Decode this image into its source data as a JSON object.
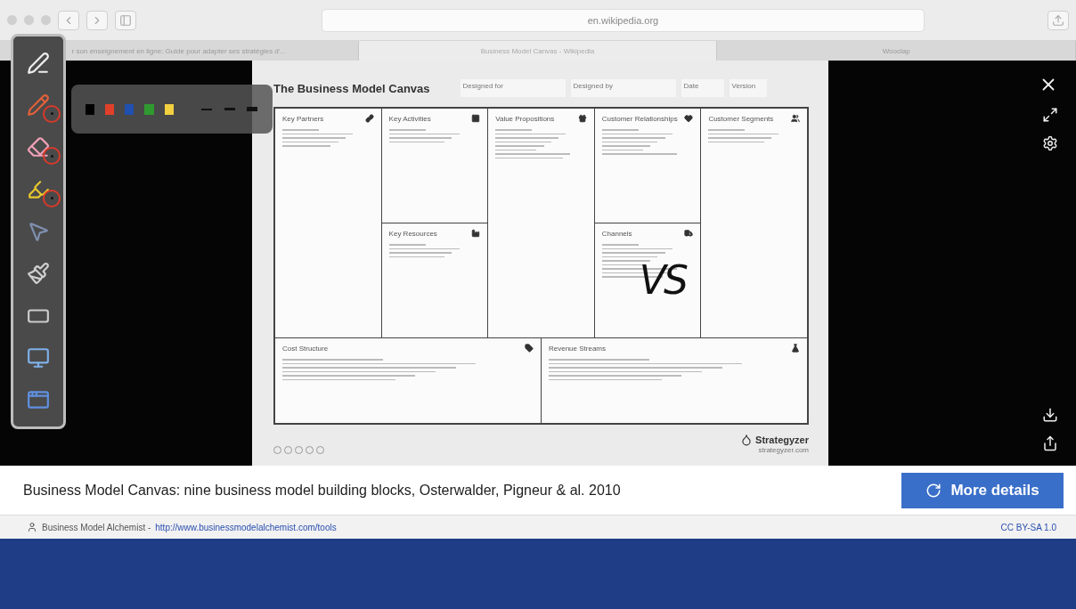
{
  "browser": {
    "address": "en.wikipedia.org",
    "tabs": [
      {
        "label": "r son enseignement en ligne: Guide pour adapter ses stratégies d'...",
        "selected": false
      },
      {
        "label": "Business Model Canvas - Wikipedia",
        "selected": true
      },
      {
        "label": "Wooclap",
        "selected": false
      }
    ]
  },
  "annotation_tools": [
    {
      "kind": "tool",
      "circled": false
    },
    {
      "kind": "pen",
      "circled": true
    },
    {
      "kind": "eraser",
      "circled": true
    },
    {
      "kind": "highlighter",
      "circled": true
    },
    {
      "kind": "pointer",
      "circled": false
    },
    {
      "kind": "brush",
      "circled": false
    },
    {
      "kind": "blank",
      "circled": false
    },
    {
      "kind": "screen",
      "circled": false
    },
    {
      "kind": "window",
      "circled": false
    }
  ],
  "palette": {
    "colors": [
      {
        "color": "#000000"
      },
      {
        "color": "#e0402a"
      },
      {
        "color": "#2050b0"
      },
      {
        "color": "#2f9a30"
      },
      {
        "color": "#f2d040"
      }
    ],
    "widths": [
      {
        "kind": "thin"
      },
      {
        "kind": "medium"
      },
      {
        "kind": "thick"
      }
    ]
  },
  "canvas": {
    "title": "The Business Model Canvas",
    "fields": [
      "Designed for",
      "Designed by",
      "Date",
      "Version"
    ],
    "blocks": [
      {
        "title": "Key Partners"
      },
      {
        "title": "Key Activities"
      },
      {
        "title": "Key Resources"
      },
      {
        "title": "Value Propositions"
      },
      {
        "title": "Customer Relationships"
      },
      {
        "title": "Channels",
        "annotation": "VS"
      },
      {
        "title": "Customer Segments"
      },
      {
        "title": "Cost Structure"
      },
      {
        "title": "Revenue Streams"
      }
    ],
    "brand": "Strategyzer",
    "brand_url": "strategyzer.com"
  },
  "caption": "Business Model Canvas: nine business model building blocks, Osterwalder, Pigneur & al. 2010",
  "details_button": "More details",
  "credit": {
    "author": "Business Model Alchemist - ",
    "link": "http://www.businessmodelalchemist.com/tools",
    "license": "CC BY-SA 1.0"
  }
}
